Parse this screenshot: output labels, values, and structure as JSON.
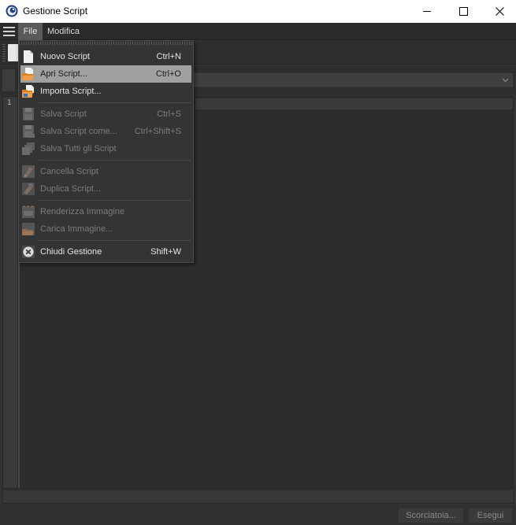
{
  "window": {
    "title": "Gestione Script",
    "app_icon": "cinema4d-logo-icon",
    "controls": [
      "minimize-icon",
      "maximize-icon",
      "close-icon"
    ]
  },
  "menubar": {
    "items": [
      {
        "label": "File",
        "active": true
      },
      {
        "label": "Modifica",
        "active": false
      }
    ]
  },
  "file_menu": {
    "items": [
      {
        "label": "Nuovo Script",
        "shortcut": "Ctrl+N",
        "enabled": true,
        "icon": "new-document-icon"
      },
      {
        "label": "Apri Script...",
        "shortcut": "Ctrl+O",
        "enabled": true,
        "highlighted": true,
        "icon": "open-folder-icon"
      },
      {
        "label": "Importa Script...",
        "shortcut": "",
        "enabled": true,
        "icon": "import-icon"
      },
      {
        "label": "Salva Script",
        "shortcut": "Ctrl+S",
        "enabled": false,
        "icon": "save-icon"
      },
      {
        "label": "Salva Script come...",
        "shortcut": "Ctrl+Shift+S",
        "enabled": false,
        "icon": "save-as-icon"
      },
      {
        "label": "Salva Tutti gli Script",
        "shortcut": "",
        "enabled": false,
        "icon": "save-all-icon"
      },
      {
        "label": "Cancella Script",
        "shortcut": "",
        "enabled": false,
        "icon": "delete-icon"
      },
      {
        "label": "Duplica Script...",
        "shortcut": "",
        "enabled": false,
        "icon": "duplicate-icon"
      },
      {
        "label": "Renderizza Immagine",
        "shortcut": "",
        "enabled": false,
        "icon": "render-icon"
      },
      {
        "label": "Carica Immagine...",
        "shortcut": "",
        "enabled": false,
        "icon": "load-image-icon"
      },
      {
        "label": "Chiudi Gestione",
        "shortcut": "Shift+W",
        "enabled": true,
        "icon": "close-circle-icon"
      }
    ]
  },
  "editor": {
    "line_numbers": [
      "1"
    ]
  },
  "footer": {
    "shortcut_button": "Scorciatoia...",
    "run_button": "Esegui"
  },
  "colors": {
    "background": "#333333",
    "menu_background": "#343434",
    "highlight": "#a0a0a0",
    "titlebar": "#ffffff"
  }
}
